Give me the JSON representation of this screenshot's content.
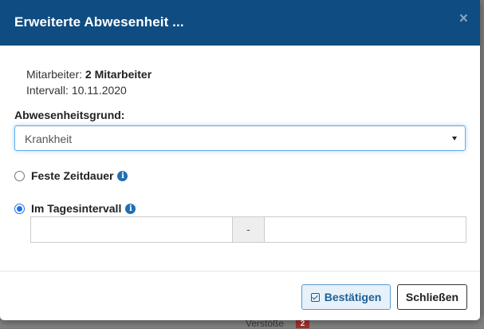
{
  "dialog": {
    "title": "Erweiterte Abwesenheit ...",
    "close_glyph": "×"
  },
  "info": {
    "employee_label": "Mitarbeiter:",
    "employee_value": "2 Mitarbeiter",
    "interval_label": "Intervall:",
    "interval_value": "10.11.2020"
  },
  "reason": {
    "label": "Abwesenheitsgrund:",
    "selected": "Krankheit"
  },
  "options": {
    "fixed_duration": {
      "label": "Feste Zeitdauer",
      "checked": false
    },
    "day_interval": {
      "label": "Im Tagesintervall",
      "checked": true
    }
  },
  "time_range": {
    "from_value": "",
    "separator": "-",
    "to_value": ""
  },
  "buttons": {
    "confirm": "Bestätigen",
    "close": "Schließen"
  },
  "background": {
    "partial_text": "Verstöße",
    "badge_count": "2"
  },
  "colors": {
    "header": "#0f4c81",
    "accent": "#1a73e8",
    "confirm_bg": "#e6f1fa"
  },
  "icons": {
    "info": "info-icon",
    "check": "check-square-icon",
    "close": "close-icon",
    "caret": "caret-down-icon"
  }
}
